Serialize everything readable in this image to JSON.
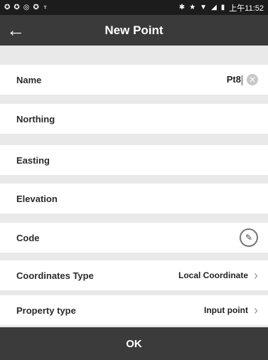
{
  "status_bar": {
    "time": "上午11:52",
    "left_icons": [
      "notification-icon",
      "notification-icon",
      "notification-icon",
      "notification-icon",
      "pin-icon"
    ],
    "right_icons": [
      "bluetooth-icon",
      "star-icon",
      "wifi-icon",
      "signal-icon",
      "battery-icon"
    ]
  },
  "app_bar": {
    "title": "New Point"
  },
  "form": {
    "name": {
      "label": "Name",
      "value": "Pt8"
    },
    "northing": {
      "label": "Northing",
      "value": ""
    },
    "easting": {
      "label": "Easting",
      "value": ""
    },
    "elevation": {
      "label": "Elevation",
      "value": ""
    },
    "code": {
      "label": "Code",
      "value": ""
    },
    "coordinates_type": {
      "label": "Coordinates Type",
      "value": "Local Coordinate"
    },
    "property_type": {
      "label": "Property type",
      "value": "Input point"
    }
  },
  "actions": {
    "ok_label": "OK"
  },
  "colors": {
    "status_bar": "#1c1c1c",
    "app_bar": "#3a3a3a",
    "background": "#e9e9e9",
    "ok_bar": "#3b3b3b"
  }
}
